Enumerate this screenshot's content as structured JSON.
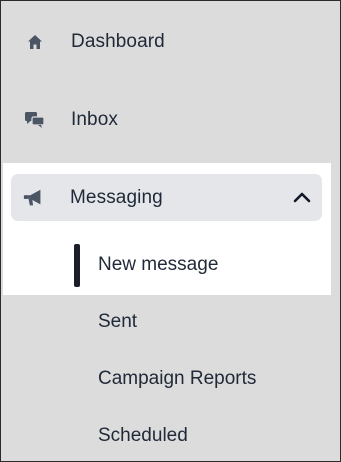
{
  "nav": {
    "items": [
      {
        "label": "Dashboard",
        "icon": "home-icon"
      },
      {
        "label": "Inbox",
        "icon": "chat-bubbles-icon"
      },
      {
        "label": "Messaging",
        "icon": "megaphone-icon",
        "expanded": true
      }
    ],
    "messaging_sub": [
      {
        "label": "New message",
        "active": true
      },
      {
        "label": "Sent"
      },
      {
        "label": "Campaign Reports"
      },
      {
        "label": "Scheduled"
      }
    ]
  },
  "colors": {
    "background": "#dcdcdc",
    "panel": "#ffffff",
    "expanded_header": "#e4e6ea",
    "text": "#1f2937",
    "icon": "#4b5563",
    "active_indicator": "#1b1f27"
  }
}
